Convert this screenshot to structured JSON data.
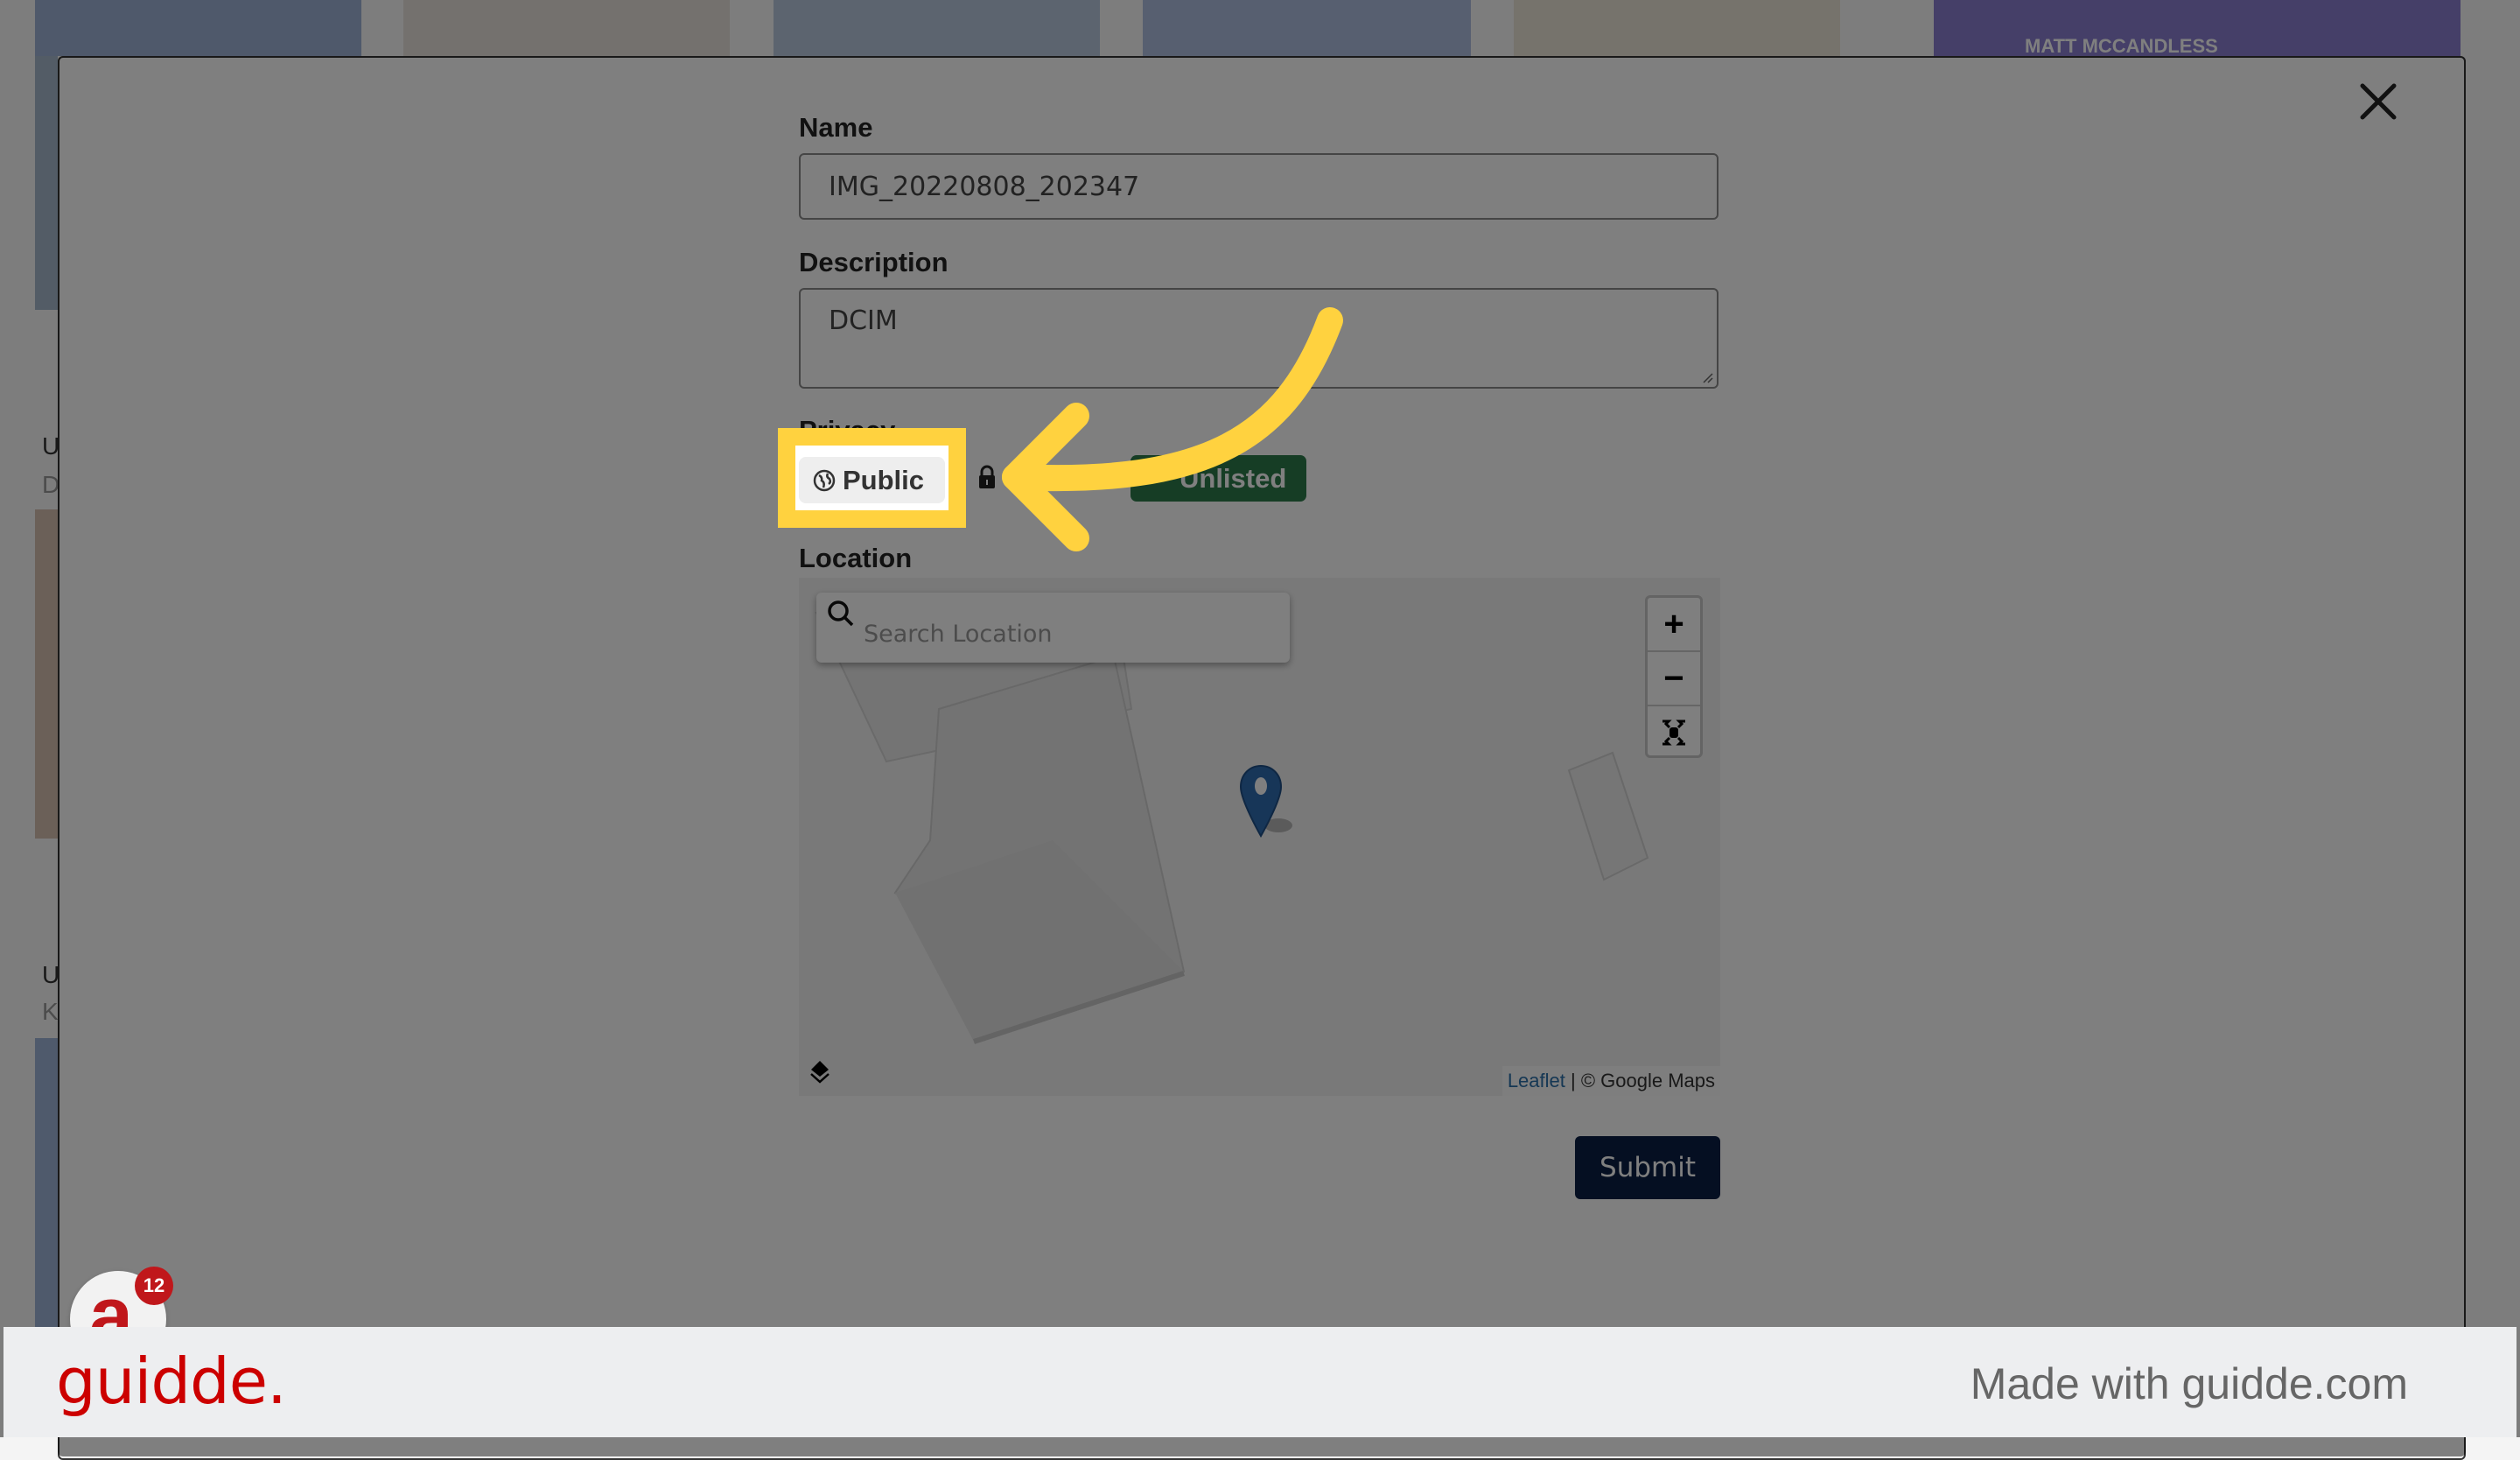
{
  "background": {
    "side_labels": [
      "U",
      "D",
      "U",
      "K"
    ],
    "banner_text": "MATT MCCANDLESS"
  },
  "modal": {
    "close_icon": "close-icon",
    "name": {
      "label": "Name",
      "value": "IMG_20220808_202347"
    },
    "description": {
      "label": "Description",
      "value": "DCIM"
    },
    "privacy": {
      "label": "Privacy",
      "options": [
        {
          "label": "Public",
          "icon": "globe-icon",
          "selected": true
        },
        {
          "label": "",
          "icon": "lock-icon",
          "selected": false
        },
        {
          "label": "Unlisted",
          "icon": "link-icon",
          "selected": false
        }
      ]
    },
    "location": {
      "label": "Location",
      "search_placeholder": "Search Location",
      "search_value": "",
      "zoom_in": "+",
      "zoom_out": "−",
      "attribution_link": "Leaflet",
      "attribution_text": " | © Google Maps"
    },
    "submit_label": "Submit"
  },
  "chat_widget": {
    "logo": "a",
    "badge_count": "12"
  },
  "footer": {
    "brand": "guidde.",
    "made_with": "Made with guidde.com"
  },
  "colors": {
    "highlight": "#ffd23f",
    "unlisted_green": "#2c7a4a",
    "submit_navy": "#0b1f44",
    "brand_red": "#cc0000"
  }
}
